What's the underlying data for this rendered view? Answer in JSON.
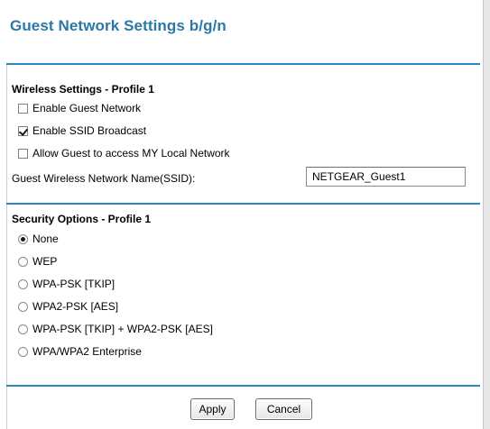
{
  "page": {
    "title": "Guest Network Settings b/g/n"
  },
  "wireless": {
    "title": "Wireless Settings - Profile 1",
    "options": [
      {
        "label": "Enable Guest Network",
        "checked": false
      },
      {
        "label": "Enable SSID Broadcast",
        "checked": true
      },
      {
        "label": "Allow Guest to access MY Local Network",
        "checked": false
      }
    ],
    "ssid_label": "Guest Wireless Network Name(SSID):",
    "ssid_value": "NETGEAR_Guest1"
  },
  "security": {
    "title": "Security Options - Profile 1",
    "selected": "None",
    "options": [
      {
        "label": "None"
      },
      {
        "label": "WEP"
      },
      {
        "label": "WPA-PSK [TKIP]"
      },
      {
        "label": "WPA2-PSK [AES]"
      },
      {
        "label": "WPA-PSK [TKIP] + WPA2-PSK [AES]"
      },
      {
        "label": "WPA/WPA2 Enterprise"
      }
    ]
  },
  "buttons": {
    "apply": "Apply",
    "cancel": "Cancel"
  },
  "colors": {
    "title": "#2a78a8",
    "divider": "#2e86c1"
  }
}
